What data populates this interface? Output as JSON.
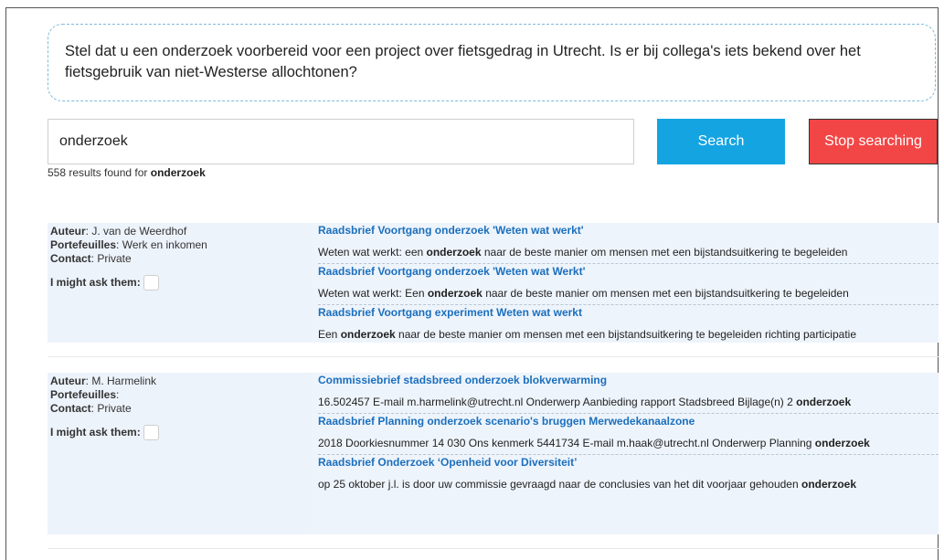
{
  "question": "Stel dat u een onderzoek voorbereid voor een project over fietsgedrag in Utrecht. Is er bij collega's iets bekend over het fietsgebruik van niet-Westerse allochtonen?",
  "search": {
    "value": "onderzoek",
    "button": "Search",
    "stop_button": "Stop searching"
  },
  "results": {
    "count": "558",
    "text": "results found for",
    "term": "onderzoek"
  },
  "labels": {
    "auteur": "Auteur",
    "portefeuilles": "Portefeuilles",
    "contact": "Contact",
    "ask": "I might ask them:"
  },
  "groups": [
    {
      "auteur": "J. van de Weerdhof",
      "portefeuilles": "Werk en inkomen",
      "contact": "Private",
      "docs": [
        {
          "title": "Raadsbrief Voortgang onderzoek 'Weten wat werkt'",
          "pre": "Weten wat werkt: een ",
          "bold": "onderzoek",
          "post": " naar de beste manier om mensen met een bijstandsuitkering te begeleiden"
        },
        {
          "title": "Raadsbrief Voortgang onderzoek 'Weten wat Werkt'",
          "pre": "Weten wat werkt: Een ",
          "bold": "onderzoek",
          "post": " naar de beste manier om mensen met een bijstandsuitkering te begeleiden"
        },
        {
          "title": "Raadsbrief Voortgang experiment Weten wat werkt",
          "pre": "Een ",
          "bold": "onderzoek",
          "post": " naar de beste manier om mensen met een bijstandsuitkering te begeleiden richting participatie"
        }
      ]
    },
    {
      "auteur": "M. Harmelink",
      "portefeuilles": "",
      "contact": "Private",
      "docs": [
        {
          "title": "Commissiebrief stadsbreed onderzoek blokverwarming",
          "pre": "16.502457 E-mail m.harmelink@utrecht.nl Onderwerp Aanbieding rapport Stadsbreed Bijlage(n) 2 ",
          "bold": "onderzoek",
          "post": ""
        },
        {
          "title": "Raadsbrief Planning onderzoek scenario's bruggen Merwedekanaalzone",
          "pre": "2018 Doorkiesnummer 14 030 Ons kenmerk 5441734 E-mail m.haak@utrecht.nl Onderwerp Planning ",
          "bold": "onderzoek",
          "post": ""
        },
        {
          "title": "Raadsbrief Onderzoek ‘Openheid voor Diversiteit’",
          "pre": "op 25 oktober j.l. is door uw commissie gevraagd naar de conclusies van het dit voorjaar gehouden ",
          "bold": "onderzoek",
          "post": ""
        }
      ]
    }
  ]
}
